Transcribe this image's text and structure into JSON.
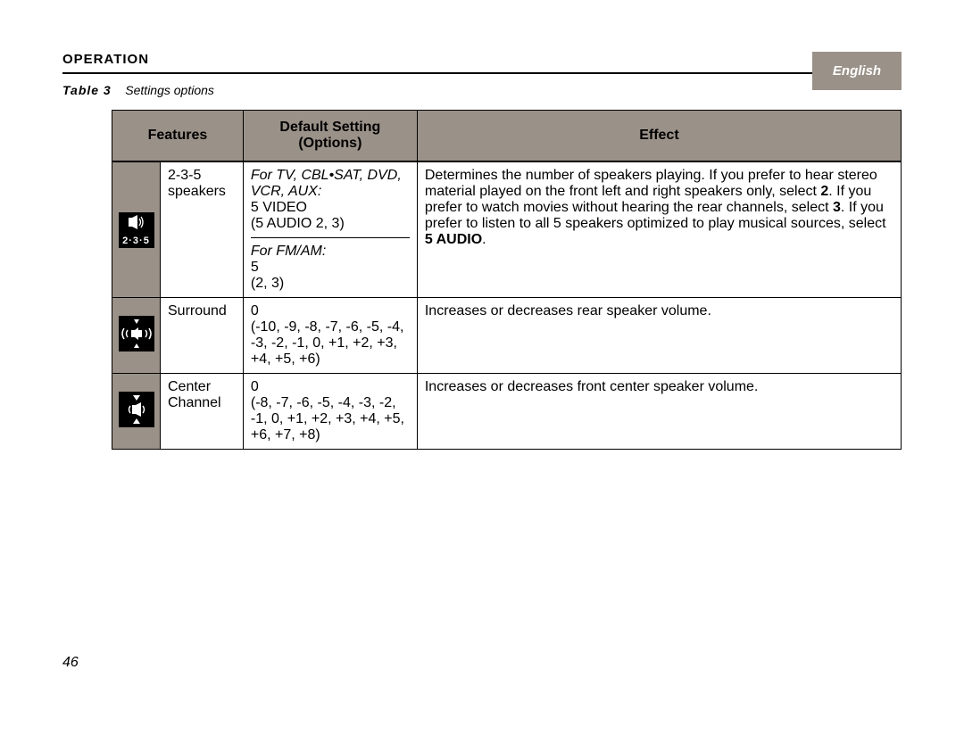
{
  "language_tab": "English",
  "section_label": "OPERATION",
  "caption": {
    "label": "Table 3",
    "title": "Settings options"
  },
  "headers": {
    "features": "Features",
    "default_line1": "Default Setting",
    "default_line2": "(Options)",
    "effect": "Effect"
  },
  "rows": [
    {
      "icon": "speakers-235",
      "icon_digits": "2·3·5",
      "feature": "2-3-5 speakers",
      "options": {
        "group1_label": "For TV, CBL•SAT, DVD, VCR, AUX:",
        "group1_default": "5 VIDEO",
        "group1_options": "(5 AUDIO 2, 3)",
        "group2_label": "For FM/AM:",
        "group2_default": "5",
        "group2_options": "(2, 3)"
      },
      "effect_pre": "Determines the number of speakers playing. If you prefer to hear stereo material played on the front left and right speakers only, select ",
      "effect_bold1": "2",
      "effect_mid1": ". If you prefer to watch movies without hearing the rear channels, select ",
      "effect_bold2": "3",
      "effect_mid2": ". If you prefer to listen to all 5 speakers optimized to play musical sources, select ",
      "effect_bold3": "5 AUDIO",
      "effect_post": "."
    },
    {
      "icon": "surround",
      "feature": "Surround",
      "options_default": "0",
      "options_list": "(-10, -9, -8, -7, -6, -5, -4, -3, -2, -1, 0, +1, +2, +3, +4, +5, +6)",
      "effect": "Increases or decreases rear speaker volume."
    },
    {
      "icon": "center",
      "feature": "Center Channel",
      "options_default": "0",
      "options_list": "(-8, -7, -6, -5, -4, -3, -2, -1, 0, +1, +2, +3, +4, +5, +6, +7, +8)",
      "effect": "Increases or decreases front center speaker volume."
    }
  ],
  "page_number": "46"
}
